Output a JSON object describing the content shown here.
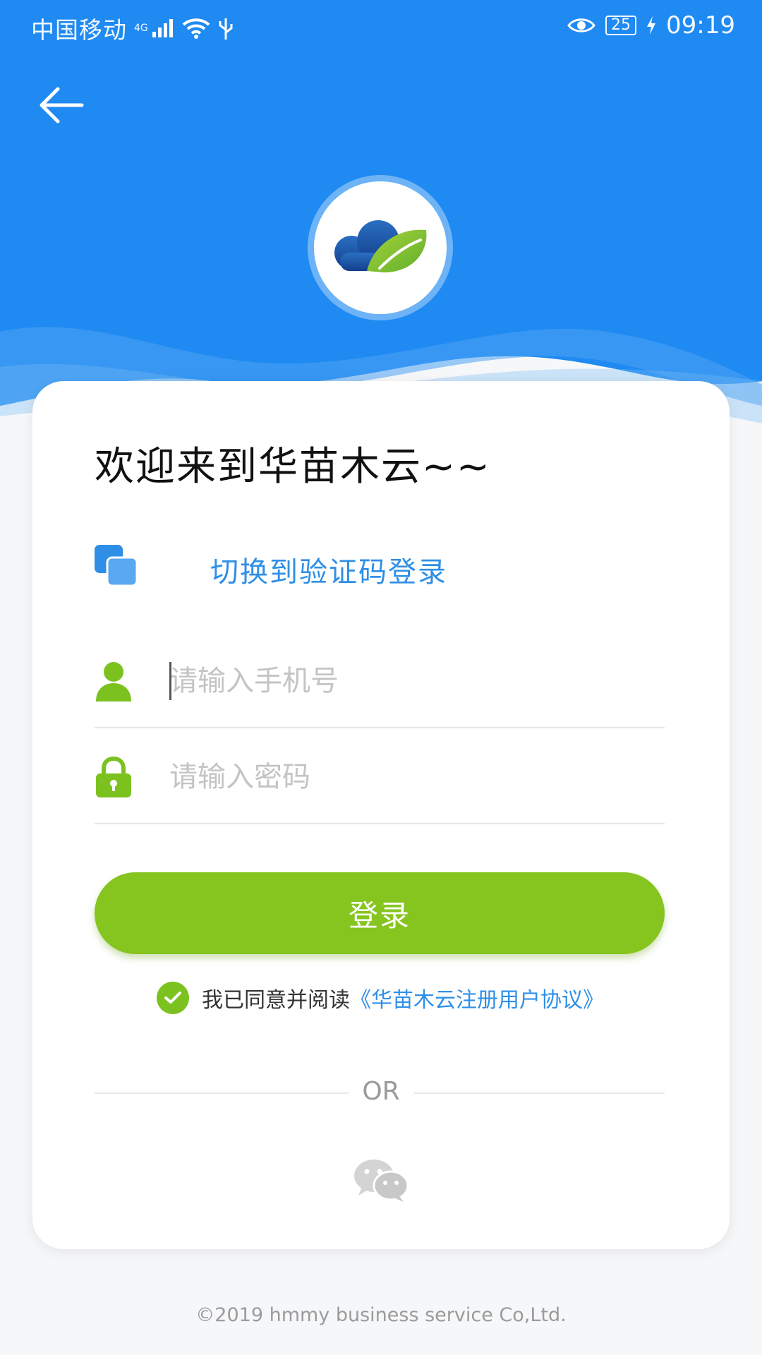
{
  "status_bar": {
    "carrier": "中国移动",
    "network": "4G",
    "battery": "25",
    "time": "09:19"
  },
  "welcome_text": "欢迎来到华苗木云~~",
  "switch_login": {
    "label": "切换到验证码登录"
  },
  "phone_field": {
    "placeholder": "请输入手机号",
    "value": ""
  },
  "password_field": {
    "placeholder": "请输入密码",
    "value": ""
  },
  "login_button": {
    "label": "登录"
  },
  "agreement": {
    "text": "我已同意并阅读",
    "link": "《华苗木云注册用户协议》",
    "checked": true
  },
  "divider": {
    "text": "OR"
  },
  "footer": {
    "copyright": "©2019 hmmy business service Co,Ltd."
  },
  "colors": {
    "primary_blue": "#1f8af2",
    "accent_green": "#86c51f",
    "link_blue": "#2f8fe6"
  },
  "icons": {
    "back": "arrow-left-icon",
    "switch": "squares-icon",
    "user": "user-icon",
    "lock": "lock-icon",
    "check": "check-icon",
    "wechat": "wechat-icon"
  }
}
